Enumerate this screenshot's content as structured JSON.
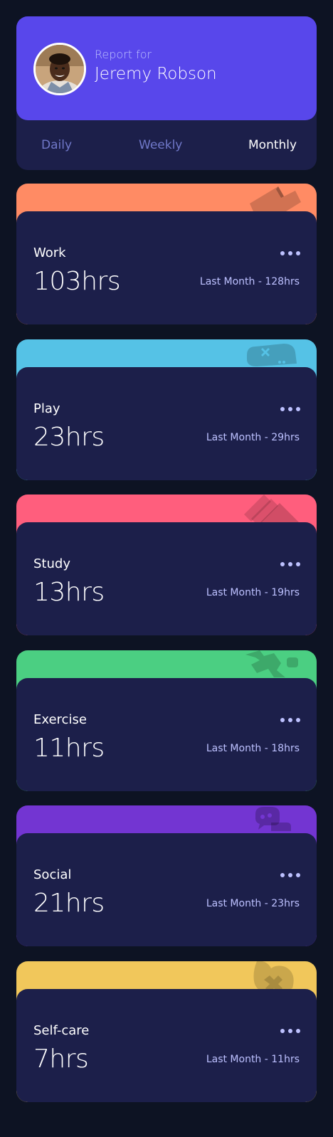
{
  "profile": {
    "report_for": "Report for",
    "name": "Jeremy Robson"
  },
  "tabs": [
    {
      "label": "Daily",
      "active": false
    },
    {
      "label": "Weekly",
      "active": false
    },
    {
      "label": "Monthly",
      "active": true
    }
  ],
  "activities": [
    {
      "title": "Work",
      "hours": "103hrs",
      "previous": "Last Month - 128hrs",
      "color": "#ff8b64",
      "icon": "briefcase-icon"
    },
    {
      "title": "Play",
      "hours": "23hrs",
      "previous": "Last Month - 29hrs",
      "color": "#55c2e6",
      "icon": "gamepad-icon"
    },
    {
      "title": "Study",
      "hours": "13hrs",
      "previous": "Last Month - 19hrs",
      "color": "#ff5e7d",
      "icon": "books-icon"
    },
    {
      "title": "Exercise",
      "hours": "11hrs",
      "previous": "Last Month - 18hrs",
      "color": "#4bcf82",
      "icon": "running-icon"
    },
    {
      "title": "Social",
      "hours": "21hrs",
      "previous": "Last Month - 23hrs",
      "color": "#7335d2",
      "icon": "chat-icon"
    },
    {
      "title": "Self-care",
      "hours": "7hrs",
      "previous": "Last Month - 11hrs",
      "color": "#f1c75b",
      "icon": "heart-icon"
    }
  ],
  "colors": {
    "background": "#0d1323",
    "card": "#1c1f4a",
    "accent": "#5847eb",
    "muted_text": "#bdc1ff",
    "inactive_tab": "#7078c9"
  }
}
